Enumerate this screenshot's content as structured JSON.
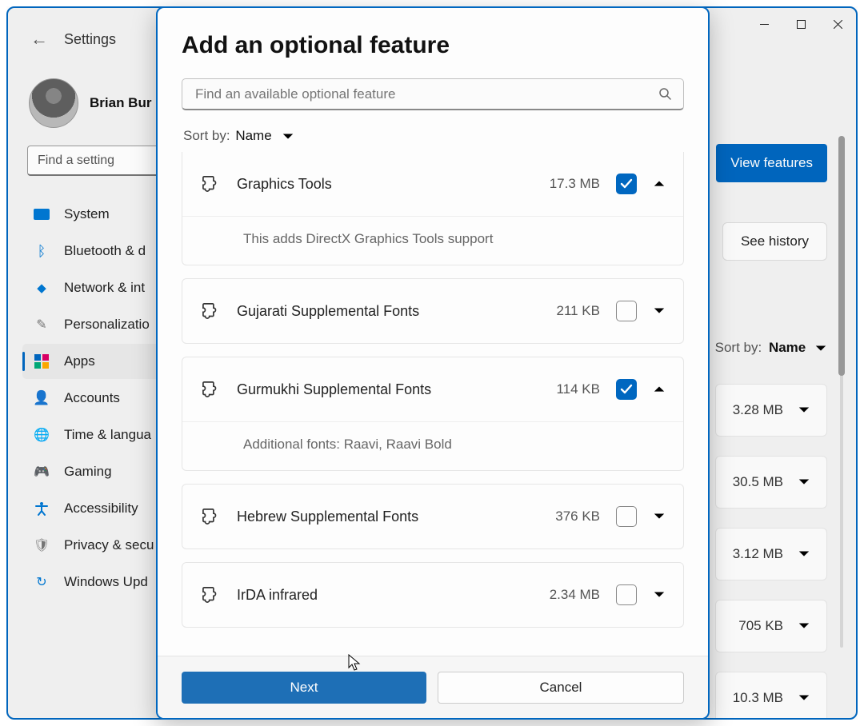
{
  "window": {
    "back_label": "Settings",
    "profile_name": "Brian Bur",
    "find_placeholder": "Find a setting",
    "nav": [
      {
        "icon": "system",
        "label": "System"
      },
      {
        "icon": "bluetooth",
        "label": "Bluetooth & d"
      },
      {
        "icon": "network",
        "label": "Network & int"
      },
      {
        "icon": "personalization",
        "label": "Personalizatio"
      },
      {
        "icon": "apps",
        "label": "Apps"
      },
      {
        "icon": "accounts",
        "label": "Accounts"
      },
      {
        "icon": "time",
        "label": "Time & langua"
      },
      {
        "icon": "gaming",
        "label": "Gaming"
      },
      {
        "icon": "accessibility",
        "label": "Accessibility"
      },
      {
        "icon": "privacy",
        "label": "Privacy & secu"
      },
      {
        "icon": "update",
        "label": "Windows Upd"
      }
    ],
    "buttons": {
      "view_features": "View features",
      "see_history": "See history"
    },
    "sort_label": "Sort by:",
    "sort_value": "Name",
    "bg_rows": [
      {
        "size": "3.28 MB"
      },
      {
        "size": "30.5 MB"
      },
      {
        "size": "3.12 MB"
      },
      {
        "size": "705 KB"
      },
      {
        "size": "10.3 MB"
      }
    ]
  },
  "dialog": {
    "title": "Add an optional feature",
    "search_placeholder": "Find an available optional feature",
    "sort_label": "Sort by:",
    "sort_value": "Name",
    "features": [
      {
        "name": "Graphics Tools",
        "size": "17.3 MB",
        "checked": true,
        "expanded": true,
        "desc": "This adds DirectX Graphics Tools support"
      },
      {
        "name": "Gujarati Supplemental Fonts",
        "size": "211 KB",
        "checked": false,
        "expanded": false
      },
      {
        "name": "Gurmukhi Supplemental Fonts",
        "size": "114 KB",
        "checked": true,
        "expanded": true,
        "desc": "Additional fonts: Raavi, Raavi Bold"
      },
      {
        "name": "Hebrew Supplemental Fonts",
        "size": "376 KB",
        "checked": false,
        "expanded": false
      },
      {
        "name": "IrDA infrared",
        "size": "2.34 MB",
        "checked": false,
        "expanded": false
      }
    ],
    "next": "Next",
    "cancel": "Cancel"
  }
}
